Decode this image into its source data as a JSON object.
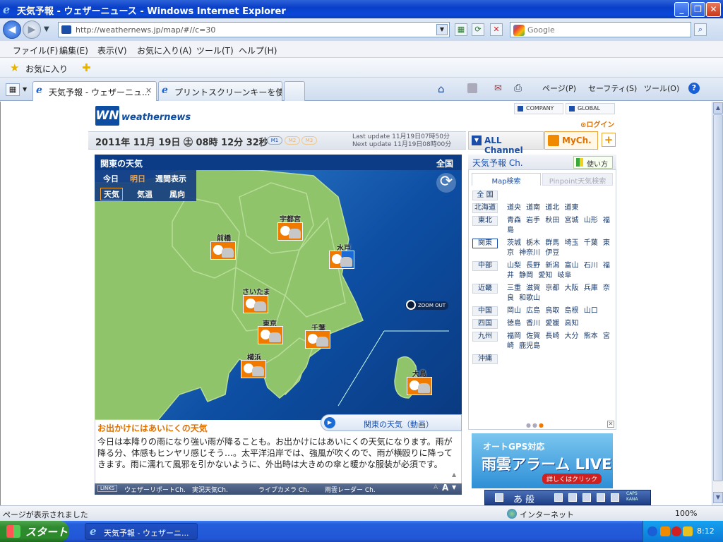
{
  "window": {
    "title": "天気予報 - ウェザーニュース - Windows Internet Explorer",
    "buttons": [
      "_",
      "❐",
      "✕"
    ]
  },
  "address": {
    "url": "http://weathernews.jp/map/#//c=30",
    "search_placeholder": "Google"
  },
  "menu": [
    "ファイル(F)",
    "編集(E)",
    "表示(V)",
    "お気に入り(A)",
    "ツール(T)",
    "ヘルプ(H)"
  ],
  "favorites": {
    "label": "お気に入り"
  },
  "tabs": [
    {
      "label": "天気予報 - ウェザーニュ..."
    },
    {
      "label": "プリントスクリーンキーを使って..."
    }
  ],
  "command_bar": {
    "page": "ページ(P)",
    "safety": "セーフティ(S)",
    "tools": "ツール(O)"
  },
  "site": {
    "logo": "WN",
    "logo_text": "weathernews",
    "company": "COMPANY",
    "global": "GLOBAL",
    "login": "ログイン",
    "date": "2011年 11月 19日 ㊏ 08時 12分 32秒",
    "modes": [
      "M1",
      "M2",
      "M3"
    ],
    "last_update": "Last update  11月19日07時50分",
    "next_update": "Next update  11月19日08時00分",
    "all_channel": "ALL Channel",
    "my_channel": "MyCh.",
    "plus": "+"
  },
  "map": {
    "title": "関東の天気",
    "nationwide": "全国",
    "day_tabs": [
      "今日",
      "明日",
      "週間表示"
    ],
    "active_day": "明日",
    "type_tabs": [
      "天気",
      "気温",
      "風向"
    ],
    "zoom_out": "ZOOM OUT",
    "cities": [
      {
        "name": "前橋"
      },
      {
        "name": "宇都宮"
      },
      {
        "name": "水戸"
      },
      {
        "name": "さいたま"
      },
      {
        "name": "東京"
      },
      {
        "name": "千葉"
      },
      {
        "name": "横浜"
      },
      {
        "name": "大島"
      }
    ]
  },
  "forecast": {
    "video": "関東の天気（動画）",
    "title": "お出かけにはあいにくの天気",
    "body": "今日は本降りの雨になり強い雨が降ることも。お出かけにはあいにくの天気になります。雨が降る分、体感もヒンヤリ感じそう…。太平洋沿岸では、強風が吹くので、雨が横殴りに降ってきます。雨に濡れて風邪を引かないように、外出時は大きめの傘と暖かな服装が必須です。"
  },
  "links": [
    "LINKS",
    "ウェザーリポートCh.",
    "実況天気Ch.",
    "ライブカメラ Ch.",
    "雨雲レーダー Ch."
  ],
  "right_panel": {
    "title": "天気予報 Ch.",
    "howto": "使い方",
    "tab_map": "Map検索",
    "tab_pinpoint": "Pinpoint天気検索",
    "regions": [
      {
        "name": "全 国",
        "prefs": ""
      },
      {
        "name": "北海道",
        "prefs": "道央 道南 道北 道東"
      },
      {
        "name": "東北",
        "prefs": "青森 岩手 秋田 宮城 山形 福島"
      },
      {
        "name": "関東",
        "prefs": "茨城 栃木 群馬 埼玉 千葉 東京 神奈川 伊豆",
        "selected": true
      },
      {
        "name": "中部",
        "prefs": "山梨 長野 新潟 富山 石川 福井 静岡 愛知 岐阜"
      },
      {
        "name": "近畿",
        "prefs": "三重 滋賀 京都 大阪 兵庫 奈良 和歌山"
      },
      {
        "name": "中国",
        "prefs": "岡山 広島 鳥取 島根 山口"
      },
      {
        "name": "四国",
        "prefs": "徳島 香川 愛媛 高知"
      },
      {
        "name": "九州",
        "prefs": "福岡 佐賀 長崎 大分 熊本 宮崎 鹿児島"
      },
      {
        "name": "沖縄",
        "prefs": ""
      }
    ],
    "ad_line1": "オートGPS対応",
    "ad_line2": "雨雲アラーム LIVE",
    "ad_line3": "詳しくはクリック"
  },
  "ime": {
    "text": "あ 般",
    "caps": "CAPS\nKANA"
  },
  "status": {
    "text": "ページが表示されました",
    "zone": "インターネット",
    "zoom": "100%"
  },
  "taskbar": {
    "start": "スタート",
    "task": "天気予報 - ウェザーニ...",
    "clock": "8:12"
  },
  "colors": {
    "accent_orange": "#f07a00",
    "brand_blue": "#0d4ea3",
    "land_green": "#8fc46a"
  }
}
